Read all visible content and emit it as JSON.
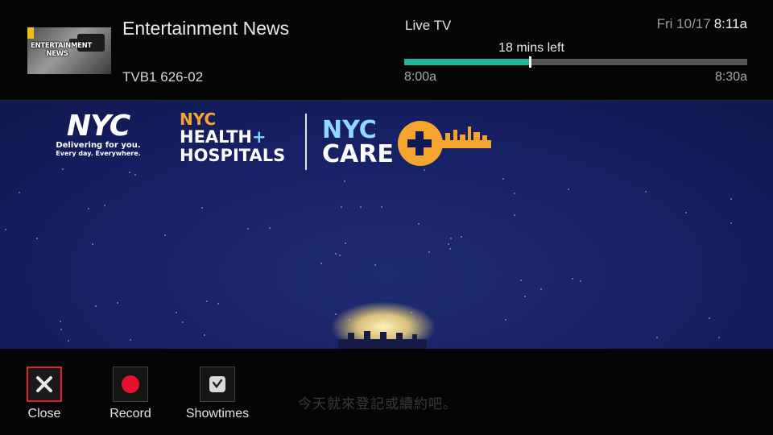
{
  "program": {
    "thumbnail_text": "ENTERTAINMENT NEWS",
    "title": "Entertainment News",
    "channel": "TVB1 626-02"
  },
  "status": {
    "source": "Live TV",
    "date": "Fri 10/17",
    "time": "8:11a",
    "time_left": "18 mins left",
    "start_time": "8:00a",
    "end_time": "8:30a",
    "progress": 0.367,
    "progress_color": "#1fb99a"
  },
  "video": {
    "logos": {
      "nyc": "NYC",
      "nyc_tagline": "Delivering for you.",
      "nyc_tagline2": "Every day. Everywhere.",
      "hh_nyc": "NYC",
      "hh_line1": "HEALTH",
      "hh_plus": "+",
      "hh_line2": "HOSPITALS",
      "care_nyc": "NYC",
      "care_word": "CARE"
    },
    "subtitle": "今天就來登記或續約吧。"
  },
  "actions": [
    {
      "label": "Close",
      "icon": "close-icon",
      "selected": true
    },
    {
      "label": "Record",
      "icon": "record-icon",
      "selected": false
    },
    {
      "label": "Showtimes",
      "icon": "clock-icon",
      "selected": false
    }
  ],
  "colors": {
    "accent": "#1fb99a",
    "selection": "#e2232a",
    "record": "#e8112d",
    "video_bg": "#162064"
  }
}
